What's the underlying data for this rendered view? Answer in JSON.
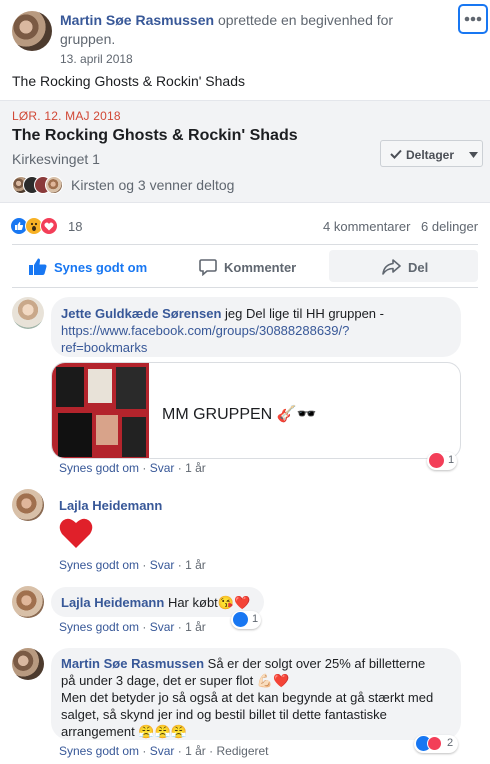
{
  "post": {
    "author": "Martin Søe Rasmussen",
    "action_text": "oprettede en begivenhed for",
    "action_text2": "gruppen.",
    "date": "13. april 2018",
    "body": "The Rocking Ghosts & Rockin' Shads",
    "menu_icon": "more-horizontal-icon"
  },
  "event": {
    "date_label": "LØR. 12. MAJ 2018",
    "title": "The Rocking Ghosts & Rockin' Shads",
    "location": "Kirkesvinget 1",
    "attend_button": "Deltager",
    "friends_text": "Kirsten og 3 venner deltog"
  },
  "stats": {
    "reactions_count": "18",
    "comments": "4 kommentarer",
    "shares": "6 delinger"
  },
  "actions": {
    "like": "Synes godt om",
    "comment": "Kommenter",
    "share": "Del"
  },
  "comments": [
    {
      "author": "Jette Guldkæde Sørensen",
      "text": "jeg Del lige til HH gruppen -",
      "link_line1": "https://www.facebook.com/groups/30888288639/?",
      "link_line2": "ref=bookmarks",
      "preview_title": "MM GRUPPEN 🎸🕶️",
      "like": "Synes godt om",
      "reply": "Svar",
      "time": "1 år",
      "react_count": "1"
    },
    {
      "author": "Lajla Heidemann",
      "text": "❤️",
      "like": "Synes godt om",
      "reply": "Svar",
      "time": "1 år"
    },
    {
      "author": "Lajla Heidemann",
      "text": "Har købt😘❤️",
      "like": "Synes godt om",
      "reply": "Svar",
      "time": "1 år",
      "react_count": "1"
    },
    {
      "author": "Martin Søe Rasmussen",
      "text_line1": "Så er der solgt over 25% af billetterne",
      "text_line2": "på under 3 dage, det er super flot 💪🏻❤️",
      "text_line3": "Men det betyder jo så også at det kan begynde at gå stærkt med",
      "text_line4": "salget, så skynd jer ind og bestil billet til dette fantastiske",
      "text_line5": "arrangement 😤😤😤",
      "like": "Synes godt om",
      "reply": "Svar",
      "time": "1 år",
      "edited": "Redigeret",
      "react_count": "2"
    }
  ],
  "separator": "·",
  "colors": {
    "link": "#385898",
    "event_date": "#d14836",
    "like_blue": "#1877f2",
    "love_red": "#f33e58"
  }
}
